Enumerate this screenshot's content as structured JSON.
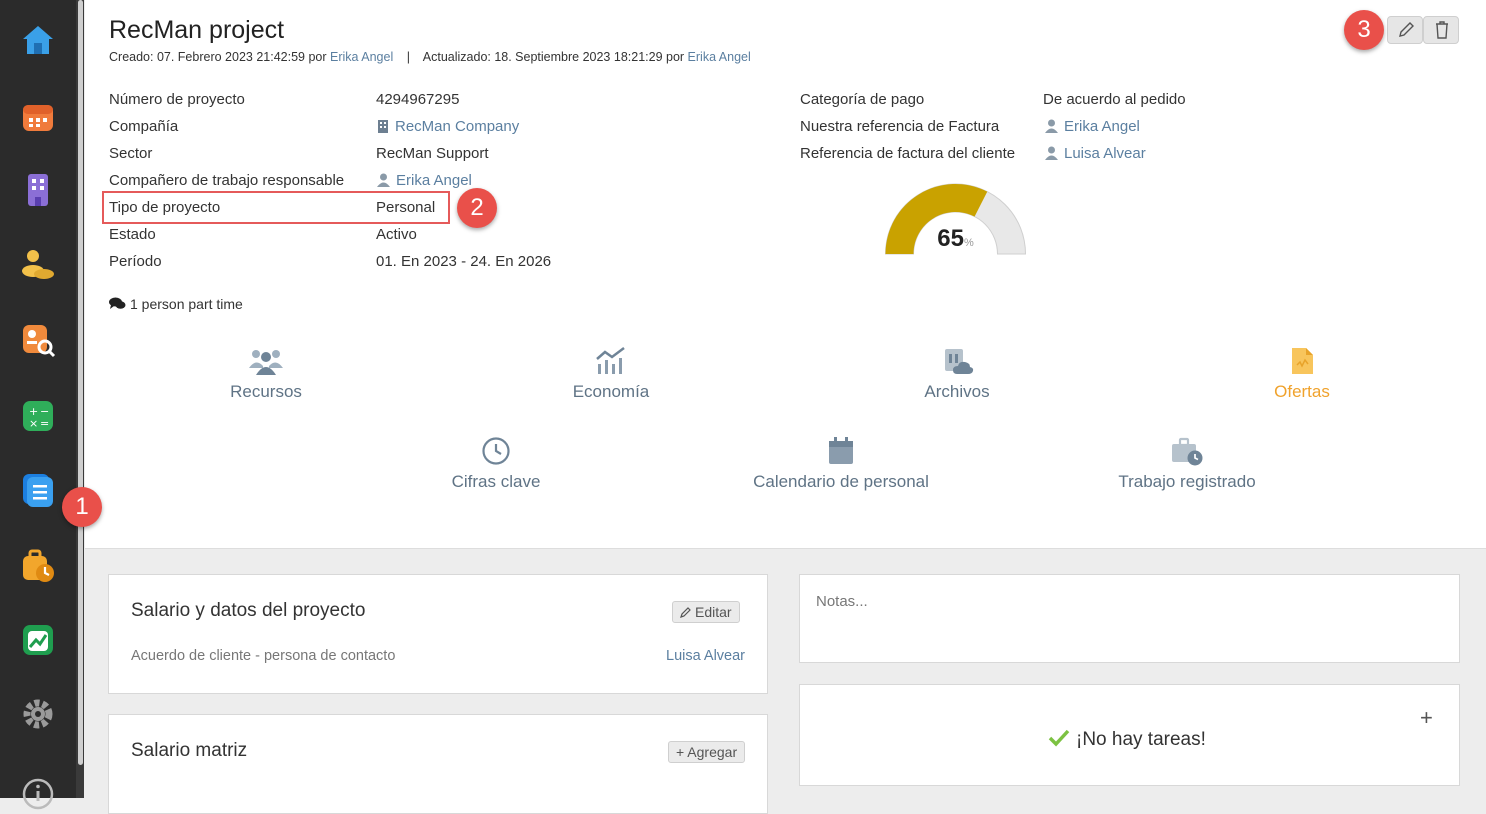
{
  "sidebar": {
    "items": [
      {
        "name": "home-icon"
      },
      {
        "name": "calendar-icon"
      },
      {
        "name": "building-icon"
      },
      {
        "name": "people-icon"
      },
      {
        "name": "candidate-search-icon"
      },
      {
        "name": "calculator-icon"
      },
      {
        "name": "projects-icon"
      },
      {
        "name": "timesheet-icon"
      },
      {
        "name": "analytics-icon"
      },
      {
        "name": "settings-icon"
      },
      {
        "name": "info-icon"
      }
    ]
  },
  "project": {
    "title": "RecMan project",
    "created_label": "Creado: 07. Febrero 2023 21:42:59 por",
    "created_by": "Erika Angel",
    "separator": "|",
    "updated_label": "Actualizado: 18. Septiembre 2023 18:21:29 por",
    "updated_by": "Erika Angel"
  },
  "details_left": [
    {
      "label": "Número de proyecto",
      "value": "4294967295"
    },
    {
      "label": "Compañía",
      "value": "RecMan Company"
    },
    {
      "label": "Sector",
      "value": "RecMan Support"
    },
    {
      "label": "Compañero de trabajo responsable",
      "value": "Erika Angel"
    },
    {
      "label": "Tipo de proyecto",
      "value": "Personal"
    },
    {
      "label": "Estado",
      "value": "Activo"
    },
    {
      "label": "Período",
      "value": "01. En 2023 - 24. En 2026"
    }
  ],
  "details_right": [
    {
      "label": "Categoría de pago",
      "value": "De acuerdo al pedido"
    },
    {
      "label": "Nuestra referencia de Factura",
      "value": "Erika Angel"
    },
    {
      "label": "Referencia de factura del cliente",
      "value": "Luisa Alvear"
    }
  ],
  "gauge": {
    "value": 65,
    "display": "65",
    "unit": "%",
    "fill_color": "#c9a200",
    "track_color": "#e8e8e8"
  },
  "comment": "1 person part time",
  "nav_tiles": [
    {
      "label": "Recursos",
      "icon": "users-icon"
    },
    {
      "label": "Economía",
      "icon": "chart-icon"
    },
    {
      "label": "Archivos",
      "icon": "files-cloud-icon"
    },
    {
      "label": "Ofertas",
      "icon": "document-offer-icon"
    },
    {
      "label": "Cifras clave",
      "icon": "clock-icon"
    },
    {
      "label": "Calendario de personal",
      "icon": "calendar-icon"
    },
    {
      "label": "Trabajo registrado",
      "icon": "briefcase-clock-icon"
    }
  ],
  "badges": [
    "1",
    "2",
    "3"
  ],
  "salary_card": {
    "title": "Salario y datos del proyecto",
    "edit_label": "Editar",
    "row_label": "Acuerdo de cliente - persona de contacto",
    "row_value": "Luisa Alvear"
  },
  "notes": {
    "placeholder": "Notas..."
  },
  "matrix_card": {
    "title": "Salario matriz",
    "add_label": "+ Agregar"
  },
  "tasks": {
    "empty_label": "¡No hay tareas!",
    "add_symbol": "+"
  },
  "colors": {
    "accent_orange": "#f0a22c",
    "link": "#5b7fa0",
    "badge": "#e9504a"
  }
}
